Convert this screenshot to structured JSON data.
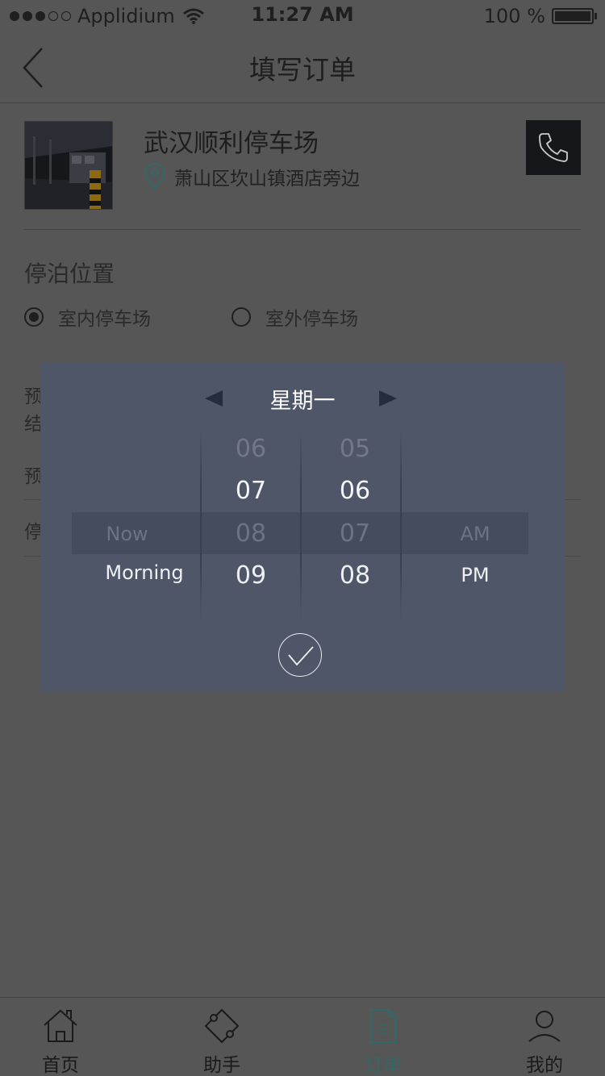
{
  "status_bar": {
    "carrier": "Applidium",
    "time": "11:27 AM",
    "battery": "100 %"
  },
  "nav": {
    "title": "填写订单"
  },
  "parking": {
    "name": "武汉顺利停车场",
    "address": "萧山区坎山镇酒店旁边"
  },
  "position": {
    "title": "停泊位置",
    "options": [
      "室内停车场",
      "室外停车场"
    ],
    "selected_index": 0
  },
  "form_rows_partial": [
    "预",
    "结",
    "预",
    "停"
  ],
  "picker": {
    "day": "星期一",
    "hours": [
      "06",
      "07",
      "08",
      "09"
    ],
    "minutes": [
      "05",
      "06",
      "07",
      "08"
    ],
    "labels": [
      "Now",
      "Morning"
    ],
    "periods": [
      "AM",
      "PM"
    ],
    "selected": {
      "hour": "08",
      "minute": "07",
      "label": "Now",
      "period": "AM"
    }
  },
  "tabs": [
    {
      "label": "首页",
      "icon": "home-icon"
    },
    {
      "label": "助手",
      "icon": "puzzle-icon"
    },
    {
      "label": "订单",
      "icon": "order-document-icon"
    },
    {
      "label": "我的",
      "icon": "profile-icon"
    }
  ],
  "active_tab_index": 2,
  "colors": {
    "accent": "#2f6a69",
    "overlay_panel": "#4f5668",
    "background": "#565656"
  }
}
